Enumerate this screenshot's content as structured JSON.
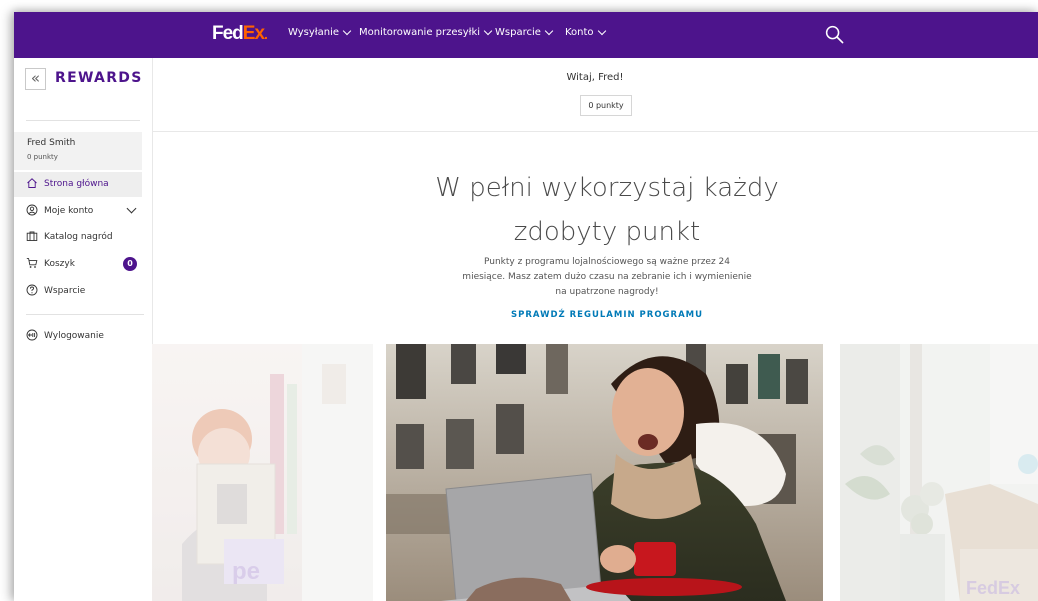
{
  "header": {
    "logo": {
      "part1": "Fed",
      "part2": "Ex",
      "dot": "."
    },
    "nav": [
      {
        "label": "Wysyłanie"
      },
      {
        "label": "Monitorowanie przesyłki"
      },
      {
        "label": "Wsparcie"
      },
      {
        "label": "Konto"
      }
    ]
  },
  "sidebar": {
    "title": "REWARDS",
    "collapse_glyph": "«",
    "user": {
      "name": "Fred Smith",
      "points": "0 punkty"
    },
    "items": [
      {
        "label": "Strona główna",
        "icon": "home-icon",
        "active": true
      },
      {
        "label": "Moje konto",
        "icon": "user-circle-icon"
      },
      {
        "label": "Katalog nagród",
        "icon": "gift-icon"
      },
      {
        "label": "Koszyk",
        "icon": "cart-icon",
        "badge": "0"
      },
      {
        "label": "Wsparcie",
        "icon": "help-icon"
      },
      {
        "label": "Wylogowanie",
        "icon": "logout-icon"
      }
    ]
  },
  "main": {
    "welcome": "Witaj, Fred!",
    "points": "0 punkty",
    "headline_line1": "W pełni wykorzystaj każdy",
    "headline_line2": "zdobyty punkt",
    "sub_line1": "Punkty z programu lojalnościowego są ważne przez 24",
    "sub_line2": "miesiące. Masz zatem dużo czasu na zebranie ich i wymienienie",
    "sub_line3": "na upatrzone nagrody!",
    "rules_link": "SPRAWDŹ REGULAMIN PROGRAMU"
  },
  "colors": {
    "brand_purple": "#4d148c",
    "brand_orange": "#ff6200",
    "link_blue": "#007ab7"
  }
}
